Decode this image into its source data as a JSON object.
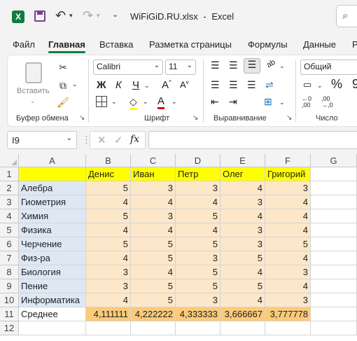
{
  "titlebar": {
    "filename": "WiFiGiD.RU.xlsx",
    "separator": "-",
    "app": "Excel"
  },
  "tabs": [
    "Файл",
    "Главная",
    "Вставка",
    "Разметка страницы",
    "Формулы",
    "Данные",
    "Р"
  ],
  "ribbon": {
    "clipboard": {
      "paste_label": "Вставить",
      "group_label": "Буфер обмена"
    },
    "font": {
      "name": "Calibri",
      "size": "11",
      "group_label": "Шрифт",
      "bold": "Ж",
      "italic": "К",
      "underline": "Ч"
    },
    "alignment": {
      "group_label": "Выравнивание"
    },
    "number": {
      "format": "Общий",
      "group_label": "Число"
    }
  },
  "formula_bar": {
    "name_box": "I9",
    "fx": "fx",
    "value": ""
  },
  "sheet": {
    "columns": [
      "A",
      "B",
      "C",
      "D",
      "E",
      "F",
      "G"
    ],
    "rows": [
      {
        "n": "1",
        "a": "",
        "vals": [
          "Денис",
          "Иван",
          "Петр",
          "Олег",
          "Григорий"
        ]
      },
      {
        "n": "2",
        "a": "Алебра",
        "vals": [
          "5",
          "3",
          "3",
          "4",
          "3"
        ]
      },
      {
        "n": "3",
        "a": "Гиометрия",
        "vals": [
          "4",
          "4",
          "4",
          "3",
          "4"
        ]
      },
      {
        "n": "4",
        "a": "Химия",
        "vals": [
          "5",
          "3",
          "5",
          "4",
          "4"
        ]
      },
      {
        "n": "5",
        "a": "Физика",
        "vals": [
          "4",
          "4",
          "4",
          "3",
          "4"
        ]
      },
      {
        "n": "6",
        "a": "Черчение",
        "vals": [
          "5",
          "5",
          "5",
          "3",
          "5"
        ]
      },
      {
        "n": "7",
        "a": "Физ-ра",
        "vals": [
          "4",
          "5",
          "3",
          "5",
          "4"
        ]
      },
      {
        "n": "8",
        "a": "Биология",
        "vals": [
          "3",
          "4",
          "5",
          "4",
          "3"
        ]
      },
      {
        "n": "9",
        "a": "Пение",
        "vals": [
          "3",
          "5",
          "5",
          "5",
          "4"
        ]
      },
      {
        "n": "10",
        "a": "Информатика",
        "vals": [
          "4",
          "5",
          "3",
          "4",
          "3"
        ]
      },
      {
        "n": "11",
        "a": "Среднее",
        "vals": [
          "4,111111",
          "4,222222",
          "4,333333",
          "3,666667",
          "3,777778"
        ]
      },
      {
        "n": "12",
        "a": "",
        "vals": [
          "",
          "",
          "",
          "",
          ""
        ]
      }
    ]
  },
  "colors": {
    "header_yellow": "#ffff00",
    "subject_blue": "#dde8f4",
    "data_orange": "#fde7c9",
    "avg_orange": "#fbcb79",
    "excel_green": "#107c41"
  }
}
